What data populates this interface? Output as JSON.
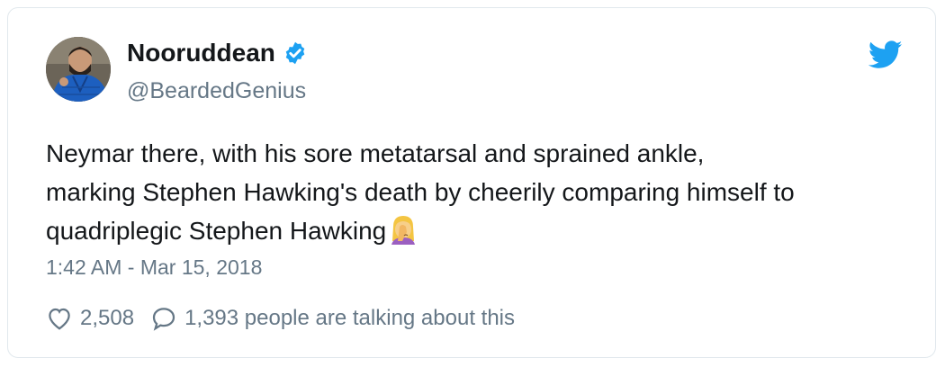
{
  "tweet": {
    "author_name": "Nooruddean",
    "author_handle": "@BeardedGenius",
    "text": "Neymar there, with his sore metatarsal and sprained ankle,\nmarking Stephen Hawking's death by cheerily comparing himself to\nquadriplegic Stephen Hawking",
    "emoji": "woman-facepalming",
    "timestamp": "1:42 AM - Mar 15, 2018",
    "likes": "2,508",
    "replies_text": "1,393 people are talking about this"
  },
  "icons": {
    "verified": "verified-badge-icon",
    "bird": "twitter-bird-icon",
    "like": "heart-icon",
    "reply": "speech-bubble-icon"
  },
  "colors": {
    "brand": "#1da1f2",
    "secondary_text": "#657786",
    "border": "#e1e8ed"
  }
}
